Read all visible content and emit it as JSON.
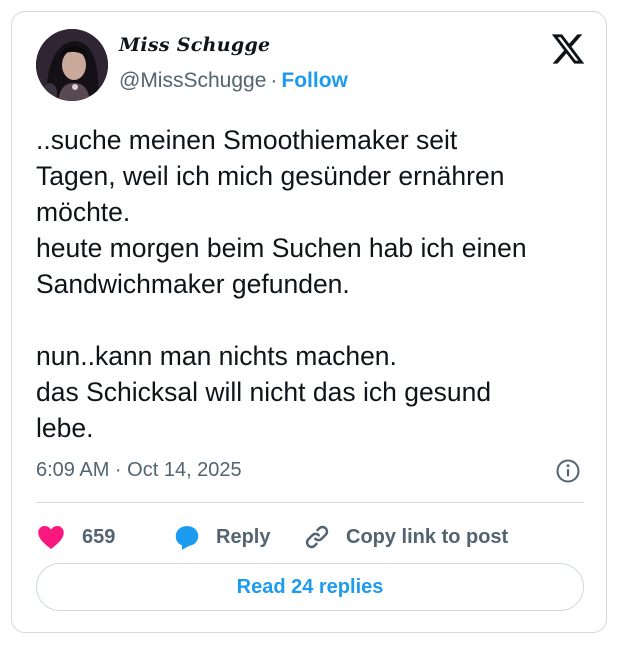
{
  "author": {
    "display_name": "Miss Schugge",
    "handle": "@MissSchugge",
    "separator": "·",
    "follow_label": "Follow"
  },
  "tweet": {
    "text": "..suche meinen Smoothiemaker seit\nTagen, weil ich mich gesünder ernähren\nmöchte.\nheute morgen beim Suchen hab ich einen\nSandwichmaker gefunden.\n\nnun..kann man nichts machen.\ndas Schicksal will nicht das ich gesund\nlebe.",
    "timestamp": "6:09 AM · Oct 14, 2025"
  },
  "actions": {
    "like_count": "659",
    "reply_label": "Reply",
    "copy_link_label": "Copy link to post"
  },
  "footer": {
    "read_replies_label": "Read 24 replies"
  },
  "icons": {
    "logo": "x-logo-icon",
    "info": "info-icon",
    "like": "heart-icon",
    "reply": "speech-bubble-icon",
    "copy_link": "link-icon"
  },
  "colors": {
    "accent": "#1d9bf0",
    "like": "#f91880",
    "text": "#0f1419",
    "muted": "#536471",
    "border": "#cfd9de"
  }
}
